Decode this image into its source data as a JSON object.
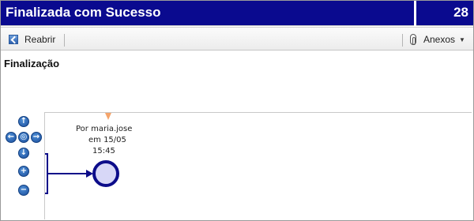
{
  "window": {
    "title": "Finalizada com Sucesso",
    "count": "28"
  },
  "toolbar": {
    "reopen_label": "Reabrir",
    "attachments_label": "Anexos"
  },
  "section": {
    "title": "Finalização"
  },
  "diagram": {
    "by_line": "Por maria.jose",
    "date_line": "em 15/05",
    "time_line": "15:45"
  },
  "nav": {
    "up": "↑",
    "left": "←",
    "center": "◎",
    "right": "→",
    "down": "↓",
    "zoom_in": "+",
    "zoom_out": "−"
  },
  "colors": {
    "titlebar": "#0a0a8f",
    "node": "#0c0c8a",
    "node_fill": "#d7d7f7",
    "accent_orange": "#f5a46b"
  },
  "icons": {
    "reopen": "reopen-icon",
    "attach": "paperclip-icon",
    "dropdown": "caret-down-icon"
  }
}
